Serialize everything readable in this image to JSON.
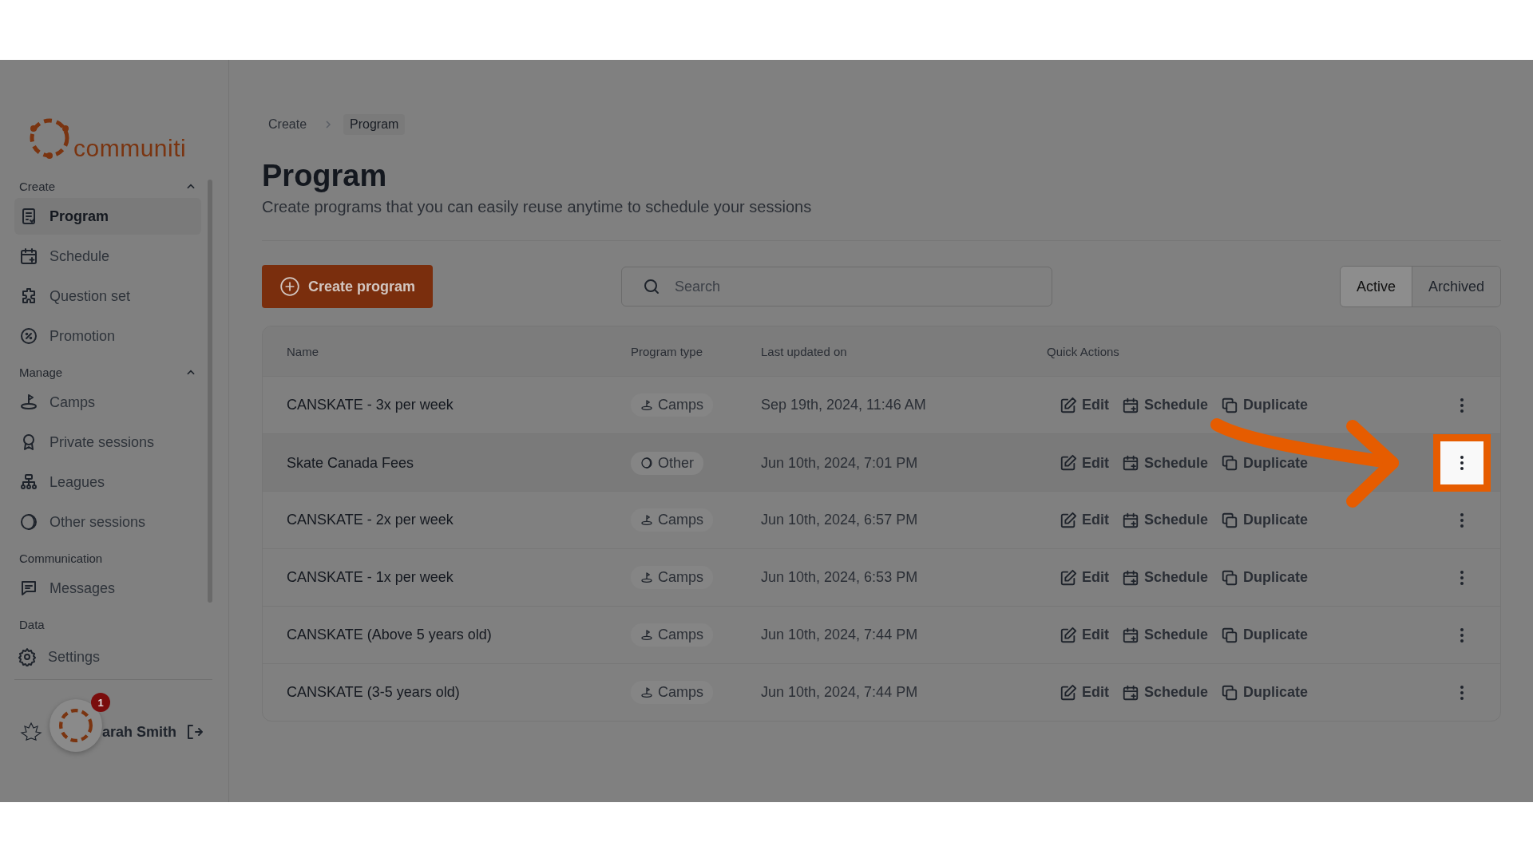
{
  "brand": {
    "name": "communiti"
  },
  "sidebar": {
    "sections": [
      {
        "label": "Create",
        "expanded": true,
        "items": [
          {
            "label": "Program",
            "selected": true
          },
          {
            "label": "Schedule",
            "selected": false
          },
          {
            "label": "Question set",
            "selected": false
          },
          {
            "label": "Promotion",
            "selected": false
          }
        ]
      },
      {
        "label": "Manage",
        "expanded": true,
        "items": [
          {
            "label": "Camps",
            "selected": false
          },
          {
            "label": "Private sessions",
            "selected": false
          },
          {
            "label": "Leagues",
            "selected": false
          },
          {
            "label": "Other sessions",
            "selected": false
          }
        ]
      },
      {
        "label": "Communication",
        "items": [
          {
            "label": "Messages",
            "selected": false
          }
        ]
      },
      {
        "label": "Data"
      }
    ],
    "settings": "Settings",
    "user": "arah Smith",
    "notification_count": "1"
  },
  "breadcrumb": [
    {
      "label": "Create",
      "selected": false
    },
    {
      "label": "Program",
      "selected": true
    }
  ],
  "page": {
    "title": "Program",
    "subtitle": "Create programs that you can easily reuse anytime to schedule your sessions"
  },
  "toolbar": {
    "create_button": "Create program",
    "search": {
      "placeholder": "Search"
    },
    "filters": [
      {
        "label": "Active",
        "selected": true
      },
      {
        "label": "Archived",
        "selected": false
      }
    ]
  },
  "table": {
    "columns": [
      "Name",
      "Program type",
      "Last updated on",
      "Quick Actions"
    ],
    "rows": [
      {
        "name": "CANSKATE - 3x per week",
        "type": {
          "label": "Camps",
          "kind": "camps"
        },
        "updated": "Sep 19th, 2024, 11:46 AM",
        "actions": [
          "Edit",
          "Schedule",
          "Duplicate"
        ],
        "highlighted": false
      },
      {
        "name": "Skate Canada Fees",
        "type": {
          "label": "Other",
          "kind": "other"
        },
        "updated": "Jun 10th, 2024, 7:01 PM",
        "actions": [
          "Edit",
          "Schedule",
          "Duplicate"
        ],
        "highlighted": true
      },
      {
        "name": "CANSKATE - 2x per week",
        "type": {
          "label": "Camps",
          "kind": "camps"
        },
        "updated": "Jun 10th, 2024, 6:57 PM",
        "actions": [
          "Edit",
          "Schedule",
          "Duplicate"
        ],
        "highlighted": false
      },
      {
        "name": "CANSKATE - 1x per week",
        "type": {
          "label": "Camps",
          "kind": "camps"
        },
        "updated": "Jun 10th, 2024, 6:53 PM",
        "actions": [
          "Edit",
          "Schedule",
          "Duplicate"
        ],
        "highlighted": false
      },
      {
        "name": "CANSKATE (Above 5 years old)",
        "type": {
          "label": "Camps",
          "kind": "camps"
        },
        "updated": "Jun 10th, 2024, 7:44 PM",
        "actions": [
          "Edit",
          "Schedule",
          "Duplicate"
        ],
        "highlighted": false
      },
      {
        "name": "CANSKATE (3-5 years old)",
        "type": {
          "label": "Camps",
          "kind": "camps"
        },
        "updated": "Jun 10th, 2024, 7:44 PM",
        "actions": [
          "Edit",
          "Schedule",
          "Duplicate"
        ],
        "highlighted": false
      }
    ]
  }
}
